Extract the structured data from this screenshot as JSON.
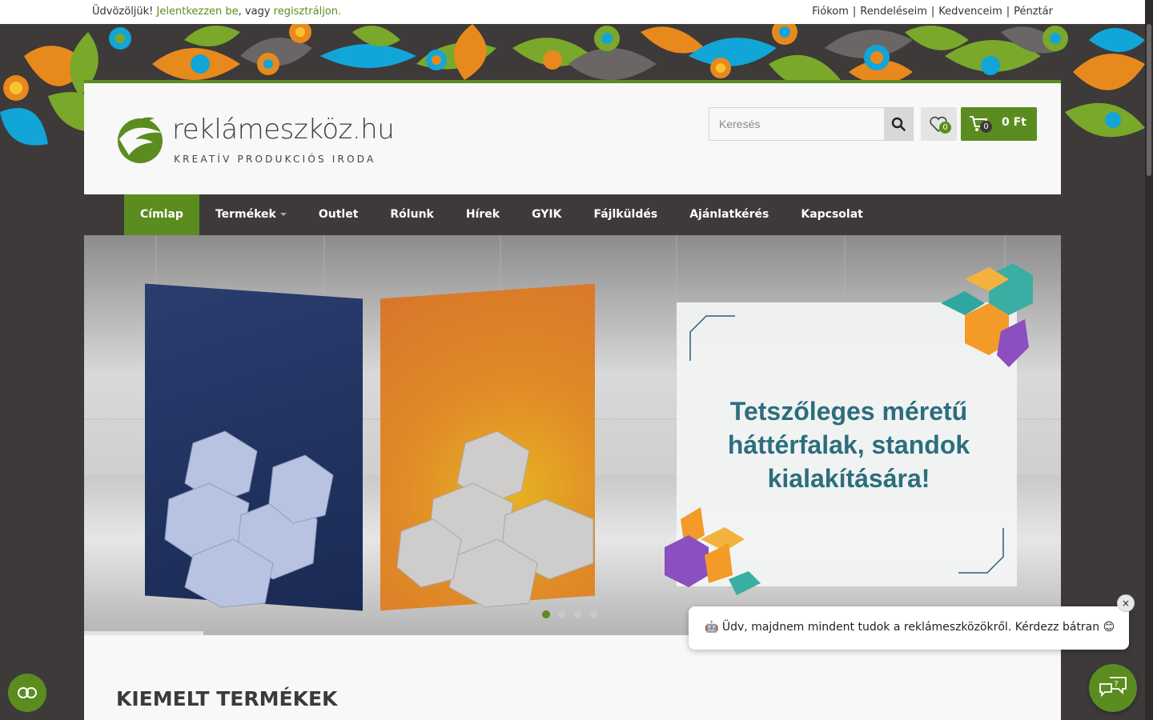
{
  "topbar": {
    "welcome": "Üdvözöljük!",
    "login_link": "Jelentkezzen be",
    "or_text": ", vagy",
    "register_link": "regisztráljon.",
    "account_links": [
      "Fiókom",
      "Rendeléseim",
      "Kedvenceim",
      "Pénztár"
    ]
  },
  "logo": {
    "name": "reklámeszköz.hu",
    "tagline": "KREATÍV PRODUKCIÓS IRODA"
  },
  "search": {
    "placeholder": "Keresés"
  },
  "favorites": {
    "count": "0"
  },
  "cart": {
    "count": "0",
    "total": "0 Ft"
  },
  "nav": {
    "items": [
      "Címlap",
      "Termékek",
      "Outlet",
      "Rólunk",
      "Hírek",
      "GYIK",
      "Fájlküldés",
      "Ajánlatkérés",
      "Kapcsolat"
    ],
    "active": "Címlap"
  },
  "slider": {
    "headline": "Tetszőleges méretű háttérfalak, standok kialakítására!",
    "slide_count": 4,
    "active_slide": 1
  },
  "content": {
    "section_title": "KIEMELT TERMÉKEK"
  },
  "chat": {
    "message": "🤖 Üdv, majdnem mindent tudok a reklámeszközökről. Kérdezz bátran 😊",
    "close": "×"
  },
  "colors": {
    "brand_green": "#5b8c1f",
    "dark": "#3d3a39",
    "headline": "#2c6e7c"
  }
}
